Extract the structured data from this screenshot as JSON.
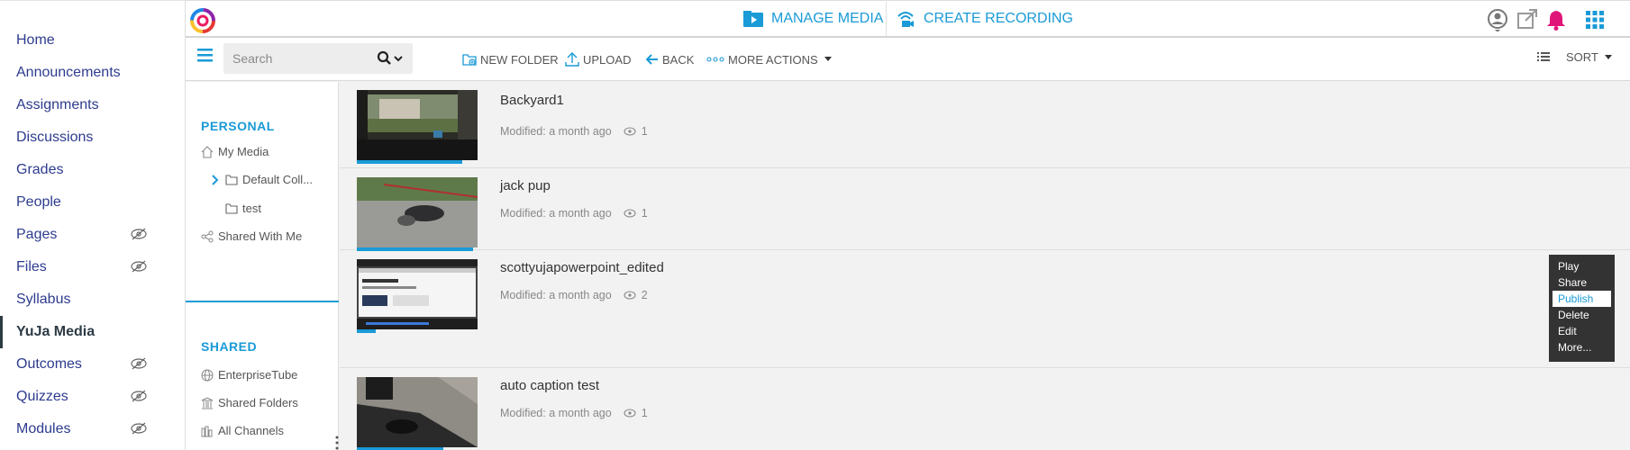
{
  "course_nav": {
    "items": [
      {
        "label": "Home"
      },
      {
        "label": "Announcements"
      },
      {
        "label": "Assignments"
      },
      {
        "label": "Discussions"
      },
      {
        "label": "Grades"
      },
      {
        "label": "People"
      },
      {
        "label": "Pages"
      },
      {
        "label": "Files"
      },
      {
        "label": "Syllabus"
      },
      {
        "label": "YuJa Media"
      },
      {
        "label": "Outcomes"
      },
      {
        "label": "Quizzes"
      },
      {
        "label": "Modules"
      }
    ]
  },
  "topbar": {
    "manage_media": "MANAGE MEDIA",
    "create_recording": "CREATE RECORDING"
  },
  "toolbar": {
    "search_placeholder": "Search",
    "new_folder": "NEW FOLDER",
    "upload": "UPLOAD",
    "back": "BACK",
    "more_actions": "MORE ACTIONS",
    "sort": "SORT"
  },
  "folders": {
    "personal_title": "PERSONAL",
    "my_media": "My Media",
    "default_collection": "Default Coll...",
    "test": "test",
    "shared_with_me": "Shared With Me",
    "shared_title": "SHARED",
    "enterprise_tube": "EnterpriseTube",
    "shared_folders": "Shared Folders",
    "all_channels": "All Channels"
  },
  "media": [
    {
      "title": "Backyard1",
      "modified": "Modified: a month ago",
      "views": "1"
    },
    {
      "title": "jack pup",
      "modified": "Modified: a month ago",
      "views": "1"
    },
    {
      "title": "scottyujapowerpoint_edited",
      "modified": "Modified: a month ago",
      "views": "2"
    },
    {
      "title": "auto caption test",
      "modified": "Modified: a month ago",
      "views": "1"
    }
  ],
  "context_menu": {
    "items": [
      "Play",
      "Share",
      "Publish",
      "Delete",
      "Edit",
      "More..."
    ]
  },
  "colors": {
    "accent": "#1a9ad7",
    "nav_link": "#2d3b8e",
    "notification": "#e0157a"
  }
}
